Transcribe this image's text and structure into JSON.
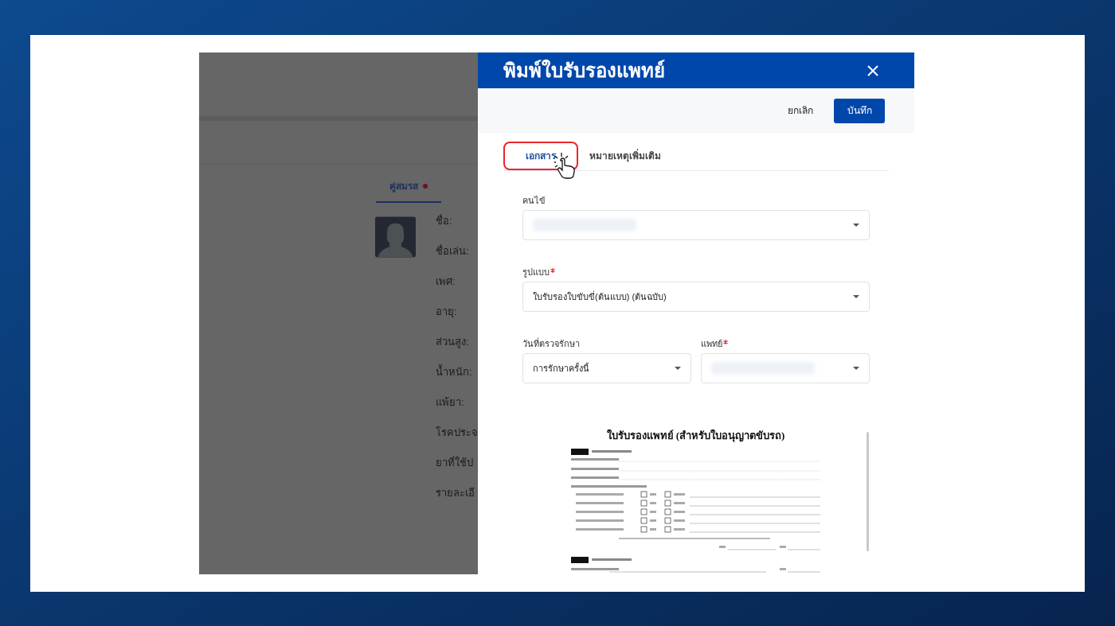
{
  "background_page": {
    "tab": {
      "label": "คู่สมรส",
      "selected": true,
      "alert": true
    },
    "fields": [
      "ชื่อ:",
      "ชื่อเล่น:",
      "เพศ:",
      "อายุ:",
      "ส่วนสูง:",
      "น้ำหนัก:",
      "แพ้ยา:",
      "โรคประจ",
      "ยาที่ใช้ป",
      "รายละเอี"
    ]
  },
  "dialog": {
    "title": "พิมพ์ใบรับรองแพทย์",
    "actions": {
      "cancel": "ยกเลิก",
      "save": "บันทึก"
    },
    "tabs": [
      {
        "label": "เอกสาร",
        "selected": true,
        "highlighted": true
      },
      {
        "label": "หมายเหตุเพิ่มเติม",
        "selected": false,
        "highlighted": false
      }
    ],
    "form_rows": [
      [
        {
          "label": "คนไข้",
          "required": false,
          "blurred": true
        }
      ],
      [
        {
          "label": "รูปแบบ",
          "required": true,
          "blurred": false,
          "value": "ใบรับรองใบขับขี่(ต้นแบบ) (ต้นฉบับ)"
        }
      ],
      [
        {
          "label": "วันที่ตรวจรักษา",
          "required": false,
          "blurred": false,
          "value": "การรักษาครั้งนี้"
        },
        {
          "label": "แพทย์",
          "required": true,
          "blurred": true
        }
      ]
    ],
    "preview": {
      "title": "ใบรับรองแพทย์ (สำหรับใบอนุญาตขับรถ)"
    }
  }
}
